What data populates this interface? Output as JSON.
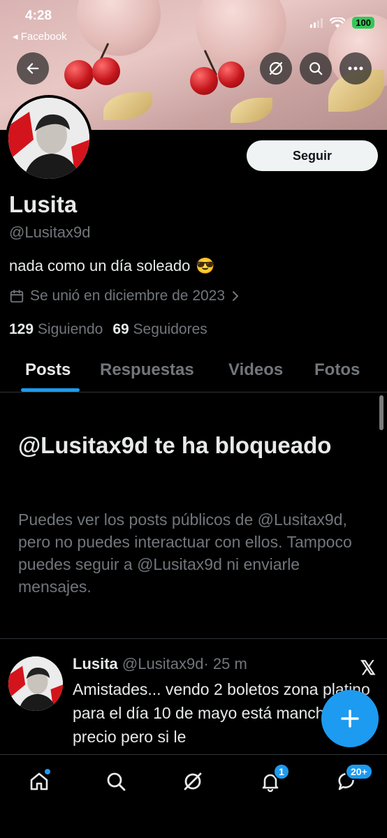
{
  "status_bar": {
    "time": "4:28",
    "back_app": "◂ Facebook",
    "battery": "100"
  },
  "profile": {
    "follow_label": "Seguir",
    "name": "Lusita",
    "handle": "@Lusitax9d",
    "bio": "nada como un día soleado",
    "bio_emoji": "😎",
    "joined": "Se unió en diciembre de 2023",
    "following_count": "129",
    "following_label": "Siguiendo",
    "followers_count": "69",
    "followers_label": "Seguidores"
  },
  "tabs": [
    "Posts",
    "Respuestas",
    "Videos",
    "Fotos"
  ],
  "blocked": {
    "title": "@Lusitax9d te ha bloqueado",
    "text": "Puedes ver los posts públicos de @Lusitax9d, pero no puedes interactuar con ellos. Tampoco puedes seguir a @Lusitax9d ni enviarle mensajes."
  },
  "tweet": {
    "name": "Lusita",
    "handle": "@Lusitax9d",
    "time": "· 25 m",
    "text": "Amistades... vendo 2 boletos zona platino para el día 10 de mayo está manchado el precio pero si le"
  },
  "bottom_nav": {
    "notifications_badge": "1",
    "messages_badge": "20+"
  },
  "colors": {
    "accent": "#1d9bf0",
    "background": "#000000",
    "muted": "#71767b"
  }
}
